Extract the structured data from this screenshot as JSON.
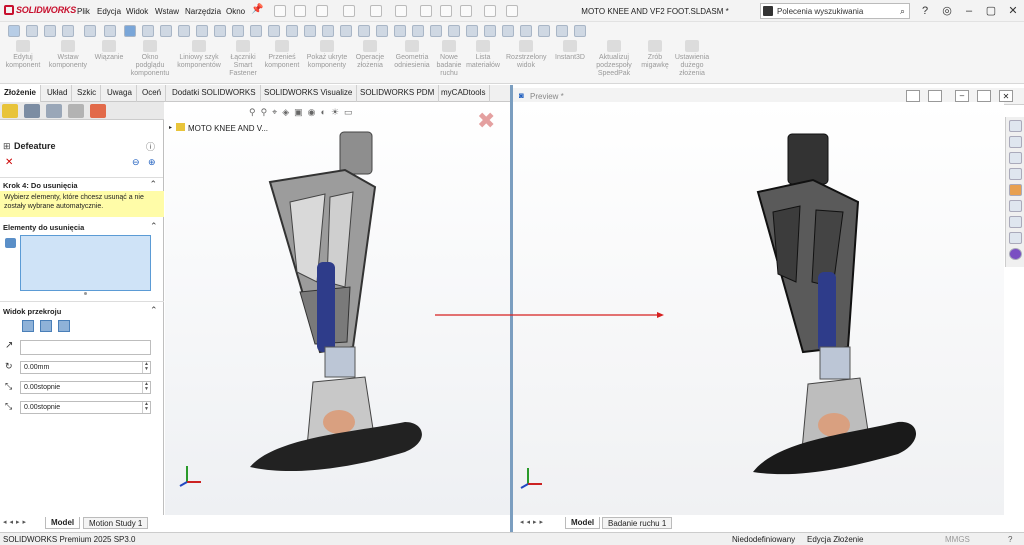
{
  "app": {
    "logo_text": "SOLIDWORKS",
    "document_title": "MOTO KNEE AND VF2 FOOT.SLDASM *"
  },
  "menu": [
    "Plik",
    "Edycja",
    "Widok",
    "Wstaw",
    "Narzędzia",
    "Okno"
  ],
  "search": {
    "placeholder": "Polecenia wyszukiwania"
  },
  "command_manager": {
    "tools": [
      {
        "label": "Edytuj komponent",
        "icon": "edit-component-icon"
      },
      {
        "label": "Wstaw komponenty",
        "icon": "insert-components-icon"
      },
      {
        "label": "Wiązanie",
        "icon": "mate-icon"
      },
      {
        "label": "Okno podglądu komponentu",
        "icon": "preview-window-icon"
      },
      {
        "label": "Liniowy szyk komponentów",
        "icon": "linear-pattern-icon"
      },
      {
        "label": "Łączniki Smart Fastener",
        "icon": "smart-fastener-icon"
      },
      {
        "label": "Przenieś komponent",
        "icon": "move-component-icon"
      },
      {
        "label": "Pokaż ukryte komponenty",
        "icon": "show-hidden-icon"
      },
      {
        "label": "Operacje złożenia",
        "icon": "assembly-features-icon"
      },
      {
        "label": "Geometria odniesienia",
        "icon": "reference-geometry-icon"
      },
      {
        "label": "Nowe badanie ruchu",
        "icon": "motion-study-icon"
      },
      {
        "label": "Lista materiałów",
        "icon": "bom-icon"
      },
      {
        "label": "Rozstrzelony widok",
        "icon": "exploded-view-icon"
      },
      {
        "label": "Instant3D",
        "icon": "instant3d-icon"
      },
      {
        "label": "Aktualizuj podzespoły SpeedPak",
        "icon": "speedpak-icon"
      },
      {
        "label": "Zrób migawkę",
        "icon": "snapshot-icon"
      },
      {
        "label": "Ustawienia dużego złożenia",
        "icon": "large-assembly-icon"
      }
    ]
  },
  "tabs": [
    "Złożenie",
    "Układ",
    "Szkic",
    "Uwaga",
    "Oceń",
    "Dodatki SOLIDWORKS",
    "SOLIDWORKS Visualize",
    "SOLIDWORKS PDM",
    "myCADtools"
  ],
  "property_manager": {
    "title": "Defeature",
    "step_heading": "Krok 4: Do usunięcia",
    "hint": "Wybierz elementy, które chcesz usunąć a nie zostały wybrane automatycznie.",
    "items_heading": "Elementy do usunięcia",
    "section_heading": "Widok przekroju",
    "offset_value": "0.00mm",
    "angle1_value": "0.00stopnie",
    "angle2_value": "0.00stopnie"
  },
  "tree": {
    "root_label": "MOTO KNEE AND V..."
  },
  "preview": {
    "title": "Preview *"
  },
  "bottom_tabs_left": [
    "Model",
    "Motion Study 1"
  ],
  "bottom_tabs_right": [
    "Model",
    "Badanie ruchu 1"
  ],
  "status": {
    "left": "SOLIDWORKS Premium 2025 SP3.0",
    "state": "Niedodefiniowany",
    "mode": "Edycja Złożenie",
    "units": "MMGS"
  },
  "colors": {
    "accent_blue": "#1f5fbf",
    "hint_yellow": "#fffca8",
    "selection_box": "#cfe3f7",
    "arrow_red": "#d62020"
  }
}
